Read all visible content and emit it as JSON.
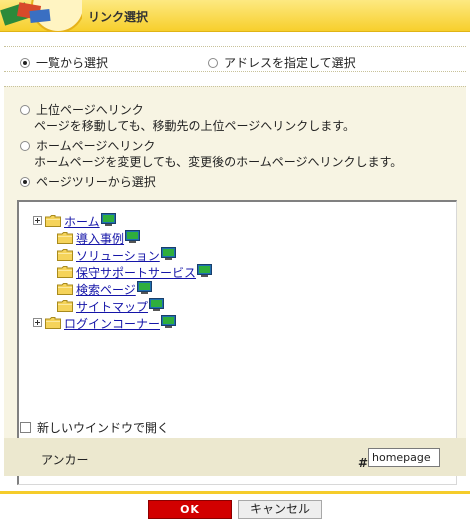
{
  "header": {
    "title": "リンク選択"
  },
  "mode": {
    "list_label": "一覧から選択",
    "list_selected": true,
    "address_label": "アドレスを指定して選択",
    "address_selected": false
  },
  "targets": [
    {
      "label": "上位ページへリンク",
      "description": "ページを移動しても、移動先の上位ページへリンクします。",
      "selected": false
    },
    {
      "label": "ホームページへリンク",
      "description": "ホームページを変更しても、変更後のホームページへリンクします。",
      "selected": false
    },
    {
      "label": "ページツリーから選択",
      "description": "",
      "selected": true
    }
  ],
  "tree": {
    "items": [
      {
        "label": "ホーム",
        "expandable": true,
        "level": 0
      },
      {
        "label": "導入事例",
        "expandable": false,
        "level": 1
      },
      {
        "label": "ソリューション",
        "expandable": false,
        "level": 1
      },
      {
        "label": "保守サポートサービス",
        "expandable": false,
        "level": 1
      },
      {
        "label": "検索ページ",
        "expandable": false,
        "level": 1
      },
      {
        "label": "サイトマップ",
        "expandable": false,
        "level": 1
      },
      {
        "label": "ログインコーナー",
        "expandable": true,
        "level": 0
      }
    ]
  },
  "new_window": {
    "label": "新しいウインドウで開く",
    "checked": false
  },
  "anchor": {
    "label": "アンカー",
    "hash": "#",
    "value": "homepage"
  },
  "buttons": {
    "ok": "OK",
    "cancel": "キャンセル"
  },
  "colors": {
    "header": "#f7cf2c",
    "panel": "#f7f4e3",
    "ok_button": "#d20000",
    "link": "#1515a8"
  }
}
